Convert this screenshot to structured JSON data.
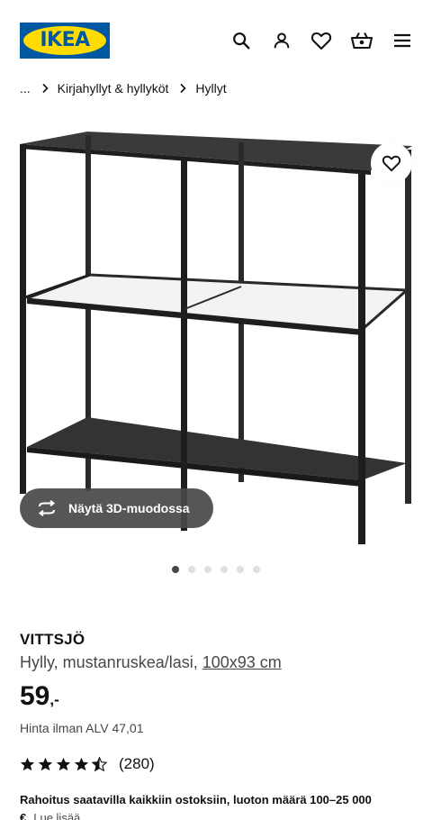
{
  "header": {
    "logo_text": "IKEA",
    "icons": [
      "search-icon",
      "account-icon",
      "heart-icon",
      "basket-icon",
      "menu-icon"
    ]
  },
  "breadcrumb": {
    "ellipsis": "...",
    "items": [
      "Kirjahyllyt & hyllyköt",
      "Hyllyt"
    ]
  },
  "gallery": {
    "view_3d_label": "Näytä 3D-muodossa",
    "image_count": 6,
    "active_index": 0
  },
  "product": {
    "name": "VITTSJÖ",
    "description": "Hylly, mustanruskea/lasi, ",
    "size_link": "100x93 cm",
    "price_integer": "59",
    "price_decimal": ",-",
    "vat_text": "Hinta ilman ALV 47,01",
    "rating_value": 4.5,
    "rating_count": "(280)"
  },
  "finance": {
    "text": "Rahoitus saatavilla kaikkiin ostoksiin, luoton määrä 100–25 000",
    "currency": "€",
    "link_text": "Lue lisää"
  },
  "colors": {
    "brand_blue": "#0058a3",
    "brand_yellow": "#ffdb00",
    "text": "#111111",
    "muted": "#484848"
  }
}
